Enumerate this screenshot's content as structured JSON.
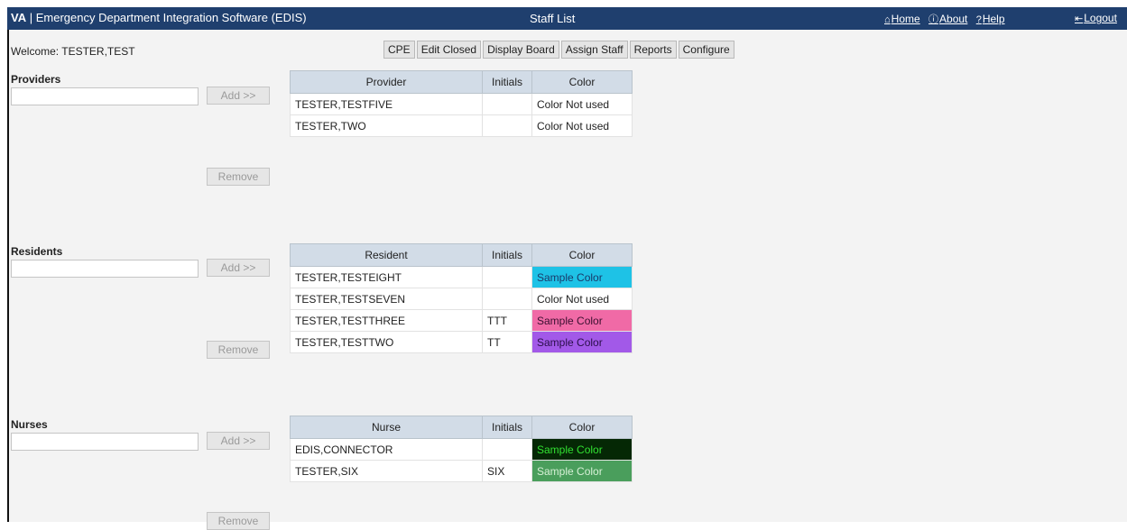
{
  "header": {
    "brand": "VA",
    "app_title": "Emergency Department Integration Software (EDIS)",
    "page_title": "Staff List",
    "links": [
      {
        "icon": "home-icon",
        "glyph": "⌂",
        "label": "Home"
      },
      {
        "icon": "info-icon",
        "glyph": "ⓘ",
        "label": "About"
      },
      {
        "icon": "help-icon",
        "glyph": "?",
        "label": "Help"
      }
    ],
    "logout": {
      "icon": "logout-icon",
      "glyph": "⇤",
      "label": "Logout"
    },
    "bg_color": "#1f3f6e"
  },
  "welcome": "Welcome: TESTER,TEST",
  "nav_buttons": [
    "CPE",
    "Edit Closed",
    "Display Board",
    "Assign Staff",
    "Reports",
    "Configure"
  ],
  "sections": [
    {
      "title": "Providers",
      "add_label": "Add >>",
      "remove_label": "Remove",
      "columns": [
        "Provider",
        "Initials",
        "Color"
      ],
      "rows": [
        {
          "name": "TESTER,TESTFIVE",
          "initials": "",
          "color_label": "Color Not used",
          "color_bg": "#ffffff",
          "color_fg": "#222222"
        },
        {
          "name": "TESTER,TWO",
          "initials": "",
          "color_label": "Color Not used",
          "color_bg": "#ffffff",
          "color_fg": "#222222"
        }
      ]
    },
    {
      "title": "Residents",
      "add_label": "Add >>",
      "remove_label": "Remove",
      "columns": [
        "Resident",
        "Initials",
        "Color"
      ],
      "rows": [
        {
          "name": "TESTER,TESTEIGHT",
          "initials": "",
          "color_label": "Sample Color",
          "color_bg": "#1ec2e6",
          "color_fg": "#1a3a6a"
        },
        {
          "name": "TESTER,TESTSEVEN",
          "initials": "",
          "color_label": "Color Not used",
          "color_bg": "#ffffff",
          "color_fg": "#222222"
        },
        {
          "name": "TESTER,TESTTHREE",
          "initials": "TTT",
          "color_label": "Sample Color",
          "color_bg": "#f06aa6",
          "color_fg": "#3a1030"
        },
        {
          "name": "TESTER,TESTTWO",
          "initials": "TT",
          "color_label": "Sample Color",
          "color_bg": "#a259e8",
          "color_fg": "#2a0f4a"
        }
      ]
    },
    {
      "title": "Nurses",
      "add_label": "Add >>",
      "remove_label": "Remove",
      "columns": [
        "Nurse",
        "Initials",
        "Color"
      ],
      "rows": [
        {
          "name": "EDIS,CONNECTOR",
          "initials": "",
          "color_label": "Sample Color",
          "color_bg": "#052805",
          "color_fg": "#32e032"
        },
        {
          "name": "TESTER,SIX",
          "initials": "SIX",
          "color_label": "Sample Color",
          "color_bg": "#4a9e5c",
          "color_fg": "#d6f0d6"
        }
      ]
    }
  ]
}
